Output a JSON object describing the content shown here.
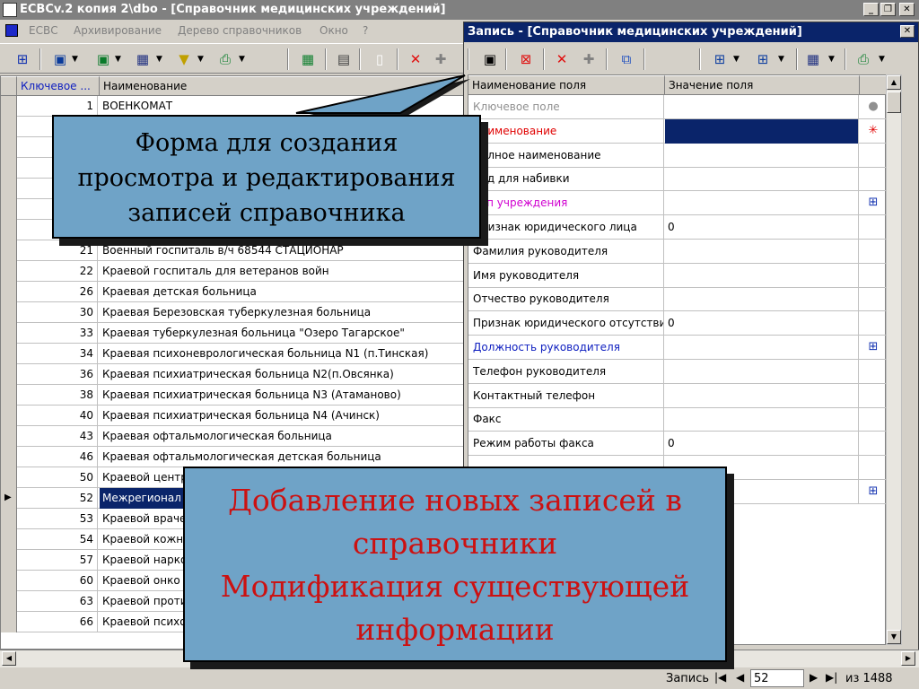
{
  "main_window": {
    "title": "ЕСВСv.2 копия 2\\dbo - [Справочник медицинских учреждений]",
    "menu": [
      "ЕСВС",
      "Архивирование",
      "Дерево справочников",
      "Окно",
      "?"
    ],
    "grid": {
      "columns": [
        "Ключевое ...",
        "Наименование"
      ],
      "rows": [
        {
          "key": "1",
          "name": "ВОЕНКОМАТ",
          "selected": false
        },
        {
          "key": "",
          "name": "",
          "selected": false
        },
        {
          "key": "",
          "name": "",
          "selected": false
        },
        {
          "key": "",
          "name": "",
          "selected": false
        },
        {
          "key": "",
          "name": "",
          "selected": false
        },
        {
          "key": "",
          "name": "",
          "selected": false
        },
        {
          "key": "",
          "name": "",
          "selected": false
        },
        {
          "key": "21",
          "name": "Военный госпиталь в/ч 68544                    СТАЦИОНАР",
          "selected": false
        },
        {
          "key": "22",
          "name": "Краевой госпиталь для ветеранов войн",
          "selected": false
        },
        {
          "key": "26",
          "name": "Краевая детская больница",
          "selected": false
        },
        {
          "key": "30",
          "name": "Краевая Березовская туберкулезная больница",
          "selected": false
        },
        {
          "key": "33",
          "name": "Краевая туберкулезная больница \"Озеро Тагарское\"",
          "selected": false
        },
        {
          "key": "34",
          "name": "Краевая психоневрологическая больница N1 (п.Тинская)",
          "selected": false
        },
        {
          "key": "36",
          "name": "Краевая психиатрическая больница N2(п.Овсянка)",
          "selected": false
        },
        {
          "key": "38",
          "name": "Краевая психиатрическая больница N3 (Атаманово)",
          "selected": false
        },
        {
          "key": "40",
          "name": "Краевая психиатрическая больница N4 (Ачинск)",
          "selected": false
        },
        {
          "key": "43",
          "name": "Краевая офтальмологическая больница",
          "selected": false
        },
        {
          "key": "46",
          "name": "Краевая офтальмологическая детская больница",
          "selected": false
        },
        {
          "key": "50",
          "name": "Краевой центр",
          "selected": false
        },
        {
          "key": "52",
          "name": "Межрегионал",
          "selected": true
        },
        {
          "key": "53",
          "name": "Краевой враче",
          "selected": false
        },
        {
          "key": "54",
          "name": "Краевой кожн",
          "selected": false
        },
        {
          "key": "57",
          "name": "Краевой нарко",
          "selected": false
        },
        {
          "key": "60",
          "name": "Краевой онко",
          "selected": false
        },
        {
          "key": "63",
          "name": "Краевой проти",
          "selected": false
        },
        {
          "key": "66",
          "name": "Краевой психо",
          "selected": false
        }
      ]
    },
    "status": {
      "record_label": "Запись",
      "record_number": "52",
      "of_label": "из 1488"
    }
  },
  "record_window": {
    "title": "Запись - [Справочник медицинских учреждений]",
    "columns": [
      "Наименование поля",
      "Значение поля"
    ],
    "fields": [
      {
        "name": "Ключевое поле",
        "value": "",
        "style": "gray",
        "icon": "dot-icon",
        "icon_glyph": "●"
      },
      {
        "name": "Наименование",
        "value": "",
        "style": "red",
        "icon": "required-asterisk-icon",
        "icon_glyph": "✳",
        "highlight": true
      },
      {
        "name": "Полное наименование",
        "value": "",
        "style": "",
        "icon": "",
        "icon_glyph": ""
      },
      {
        "name": "Код для набивки",
        "value": "",
        "style": "",
        "icon": "",
        "icon_glyph": ""
      },
      {
        "name": "Тип учреждения",
        "value": "",
        "style": "mag",
        "icon": "lookup-tree-icon",
        "icon_glyph": "⊞"
      },
      {
        "name": "Признак юридического лица",
        "value": "0",
        "style": "",
        "icon": "",
        "icon_glyph": ""
      },
      {
        "name": "Фамилия руководителя",
        "value": "",
        "style": "",
        "icon": "",
        "icon_glyph": ""
      },
      {
        "name": "Имя руководителя",
        "value": "",
        "style": "",
        "icon": "",
        "icon_glyph": ""
      },
      {
        "name": "Отчество руководителя",
        "value": "",
        "style": "",
        "icon": "",
        "icon_glyph": ""
      },
      {
        "name": "Признак юридического отсутствия",
        "value": "0",
        "style": "",
        "icon": "",
        "icon_glyph": ""
      },
      {
        "name": "Должность руководителя",
        "value": "",
        "style": "blue",
        "icon": "lookup-tree-icon",
        "icon_glyph": "⊞"
      },
      {
        "name": "Телефон руководителя",
        "value": "",
        "style": "",
        "icon": "",
        "icon_glyph": ""
      },
      {
        "name": "Контактный телефон",
        "value": "",
        "style": "",
        "icon": "",
        "icon_glyph": ""
      },
      {
        "name": "Факс",
        "value": "",
        "style": "",
        "icon": "",
        "icon_glyph": ""
      },
      {
        "name": "Режим работы факса",
        "value": "0",
        "style": "",
        "icon": "",
        "icon_glyph": ""
      },
      {
        "name": "",
        "value": "",
        "style": "",
        "icon": "",
        "icon_glyph": ""
      },
      {
        "name": "",
        "value": "",
        "style": "",
        "icon": "lookup-tree-icon",
        "icon_glyph": "⊞"
      }
    ]
  },
  "callouts": {
    "top": [
      "Форма для создания",
      "просмотра и редактирования",
      "записей справочника"
    ],
    "bottom": [
      "Добавление новых записей в",
      "справочники",
      "Модификация существующей",
      "информации"
    ]
  },
  "colors": {
    "title_active": "#0a246a",
    "callout_bg": "#6fa3c7",
    "callout_bottom_text": "#cc1111"
  }
}
